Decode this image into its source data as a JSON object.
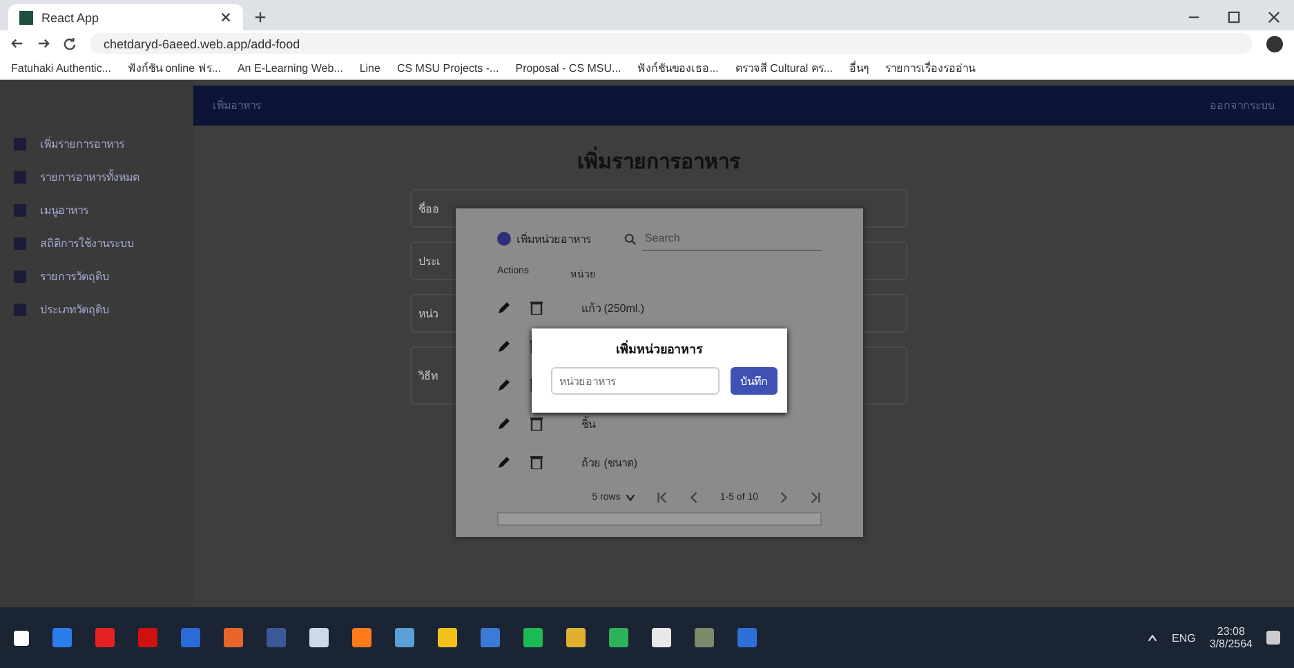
{
  "browser": {
    "tab_title": "React App",
    "url": "chetdaryd-6aeed.web.app/add-food",
    "bookmarks": [
      "Fatuhaki Authentic...",
      "ฟังก์ชัน online ฟร...",
      "An E-Learning Web...",
      "Line",
      "CS MSU Projects -...",
      "Proposal - CS MSU...",
      "ฟังก์ชันของเธอ...",
      "ตรวจสี Cultural คร...",
      "อื่นๆ",
      "รายการเรื่องรออ่าน"
    ]
  },
  "app": {
    "appbar_title": "เพิ่มอาหาร",
    "appbar_action": "ออกจากระบบ",
    "sidebar": {
      "items": [
        {
          "label": "เพิ่มรายการอาหาร"
        },
        {
          "label": "รายการอาหารทั้งหมด"
        },
        {
          "label": "เมนูอาหาร"
        },
        {
          "label": "สถิติการใช้งานระบบ"
        },
        {
          "label": "รายการวัตถุดิบ"
        },
        {
          "label": "ประเภทวัตถุดิบ"
        }
      ]
    },
    "page_title": "เพิ่มรายการอาหาร",
    "form_fields": [
      {
        "value": "ชื่ออ"
      },
      {
        "value": "ประเ"
      },
      {
        "value": "หน่ว"
      },
      {
        "value": "วิธีท"
      }
    ]
  },
  "units_dialog": {
    "add_label": "เพิ่มหน่วยอาหาร",
    "search": {
      "placeholder": "Search"
    },
    "columns": [
      "Actions",
      "หน่วย"
    ],
    "rows": [
      {
        "unit": "แก้ว (250ml.)"
      },
      {
        "unit": ""
      },
      {
        "unit": ""
      },
      {
        "unit": "ชิ้น"
      },
      {
        "unit": "ถ้วย (ขนาด)"
      }
    ],
    "pagination": {
      "rows_per_page": "5 rows",
      "range": "1-5 of 10"
    }
  },
  "add_unit_dialog": {
    "title": "เพิ่มหน่วยอาหาร",
    "field": {
      "placeholder": "หน่วยอาหาร"
    },
    "save_button": "บันทึก"
  },
  "taskbar": {
    "lang": "ENG",
    "time": "23:08",
    "date": "3/8/2564"
  }
}
